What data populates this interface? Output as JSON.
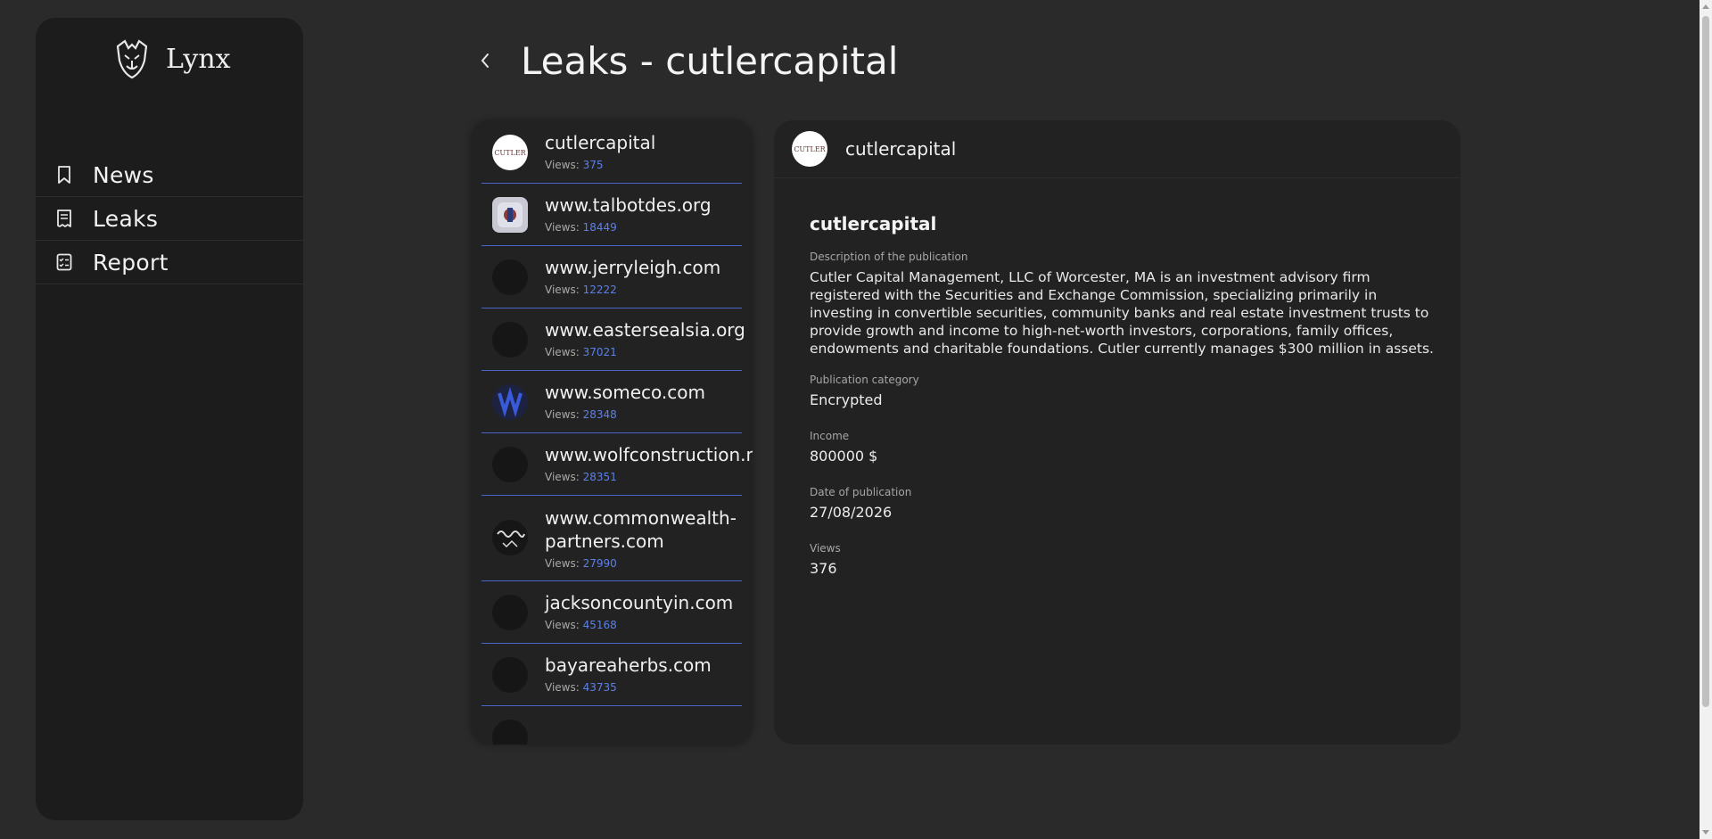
{
  "app": {
    "name": "Lynx"
  },
  "sidebar": {
    "items": [
      {
        "label": "News",
        "icon": "bookmark-icon"
      },
      {
        "label": "Leaks",
        "icon": "receipt-icon"
      },
      {
        "label": "Report",
        "icon": "checklist-icon"
      }
    ]
  },
  "header": {
    "title": "Leaks - cutlercapital"
  },
  "leaks": [
    {
      "name": "cutlercapital",
      "views_label": "Views:",
      "views": "375"
    },
    {
      "name": "www.talbotdes.org",
      "views_label": "Views:",
      "views": "18449"
    },
    {
      "name": "www.jerryleigh.com",
      "views_label": "Views:",
      "views": "12222"
    },
    {
      "name": "www.eastersealsia.org",
      "views_label": "Views:",
      "views": "37021"
    },
    {
      "name": "www.someco.com",
      "views_label": "Views:",
      "views": "28348"
    },
    {
      "name": "www.wolfconstruction.net",
      "views_label": "Views:",
      "views": "28351"
    },
    {
      "name": "www.commonwealth-partners.com",
      "views_label": "Views:",
      "views": "27990"
    },
    {
      "name": "jacksoncountyin.com",
      "views_label": "Views:",
      "views": "45168"
    },
    {
      "name": "bayareaherbs.com",
      "views_label": "Views:",
      "views": "43735"
    }
  ],
  "detail": {
    "header_name": "cutlercapital",
    "title": "cutlercapital",
    "avatar_text": "CUTLER",
    "description_label": "Description of the publication",
    "description": "Cutler Capital Management, LLC of Worcester, MA is an investment advisory firm registered with the Securities and Exchange Commission, specializing primarily in investing in convertible securities, community banks and real estate investment trusts to provide growth and income to high-net-worth investors, corporations, family offices, endowments and charitable foundations. Cutler currently manages $300 million in assets.",
    "category_label": "Publication category",
    "category": "Encrypted",
    "income_label": "Income",
    "income": "800000 $",
    "date_label": "Date of publication",
    "date": "27/08/2026",
    "views_label": "Views",
    "views": "376"
  },
  "colors": {
    "background": "#2a2a2a",
    "panel": "#222222",
    "sidebar": "#1c1c1c",
    "accent": "#5c80e6",
    "divider": "#4a64c8"
  }
}
